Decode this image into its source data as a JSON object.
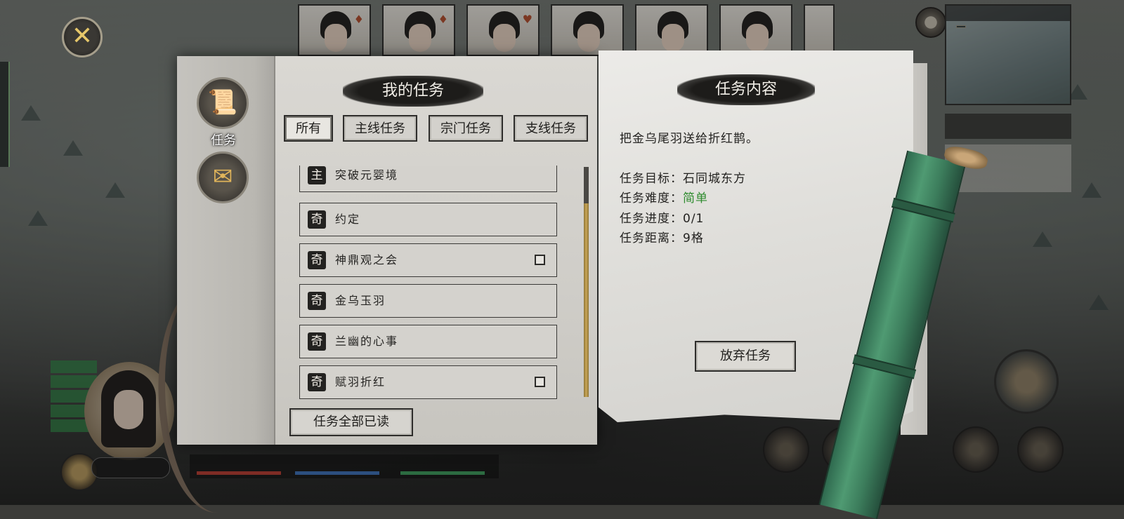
{
  "close_button": {
    "icon": "close-icon",
    "glyph": "✕"
  },
  "side_nav": {
    "quest_button": {
      "icon": "scroll-icon",
      "label": "任务"
    },
    "letter_button": {
      "icon": "letter-icon"
    }
  },
  "quest_panel": {
    "title": "我的任务",
    "filters": [
      {
        "label": "所有",
        "active": true
      },
      {
        "label": "主线任务",
        "active": false
      },
      {
        "label": "宗门任务",
        "active": false
      },
      {
        "label": "支线任务",
        "active": false
      }
    ],
    "quests": [
      {
        "type": "主",
        "name": "突破元婴境",
        "has_checkbox": false
      },
      {
        "type": "奇",
        "name": "约定",
        "has_checkbox": false
      },
      {
        "type": "奇",
        "name": "神鼎观之会",
        "has_checkbox": true
      },
      {
        "type": "奇",
        "name": "金乌玉羽",
        "has_checkbox": false
      },
      {
        "type": "奇",
        "name": "兰幽的心事",
        "has_checkbox": false
      },
      {
        "type": "奇",
        "name": "赋羽折红",
        "has_checkbox": true
      }
    ],
    "read_all_label": "任务全部已读"
  },
  "detail_panel": {
    "title": "任务内容",
    "description": "把金乌尾羽送给折红鹊。",
    "rows": [
      {
        "label": "任务目标：",
        "value": "石同城东方"
      },
      {
        "label": "任务难度：",
        "value": "简单"
      },
      {
        "label": "任务进度：",
        "value": "0/1"
      },
      {
        "label": "任务距离：",
        "value": "9格"
      }
    ],
    "abandon_label": "放弃任务"
  },
  "colors": {
    "difficulty_easy": "#2e8b2e",
    "scrollbar": "#c9a658",
    "bamboo": "#4f9a72"
  }
}
